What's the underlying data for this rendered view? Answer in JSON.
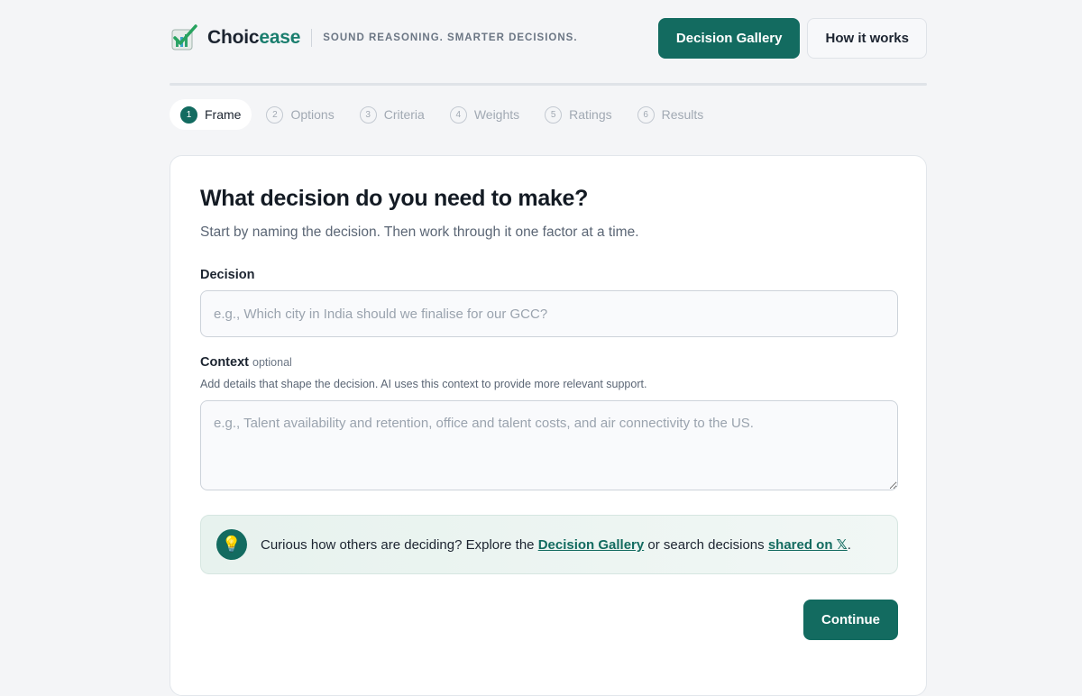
{
  "brand": {
    "name_main": "Choic",
    "name_accent": "ease",
    "tagline": "SOUND REASONING. SMARTER DECISIONS.",
    "logo_icon": "checkmark-chart-icon"
  },
  "nav": {
    "gallery_label": "Decision Gallery",
    "how_label": "How it works"
  },
  "steps": [
    {
      "num": "1",
      "label": "Frame"
    },
    {
      "num": "2",
      "label": "Options"
    },
    {
      "num": "3",
      "label": "Criteria"
    },
    {
      "num": "4",
      "label": "Weights"
    },
    {
      "num": "5",
      "label": "Ratings"
    },
    {
      "num": "6",
      "label": "Results"
    }
  ],
  "active_step": 1,
  "card": {
    "title": "What decision do you need to make?",
    "subtitle": "Start by naming the decision. Then work through it one factor at a time.",
    "decision_label": "Decision",
    "decision_value": "",
    "decision_placeholder": "e.g., Which city in India should we finalise for our GCC?",
    "context_label": "Context",
    "context_optional": "optional",
    "context_help": "Add details that shape the decision. AI uses this context to provide more relevant support.",
    "context_value": "",
    "context_placeholder": "e.g., Talent availability and retention, office and talent costs, and air connectivity to the US.",
    "tip": {
      "icon": "lightbulb-icon",
      "text_before": "Curious how others are deciding? Explore the ",
      "gallery_link": "Decision Gallery",
      "text_middle": " or search decisions ",
      "x_link": "shared on 𝕏",
      "text_after": "."
    },
    "continue_label": "Continue"
  },
  "colors": {
    "primary": "#136b60",
    "accent_text": "#1a7e6e",
    "background": "#f4f5f7"
  }
}
